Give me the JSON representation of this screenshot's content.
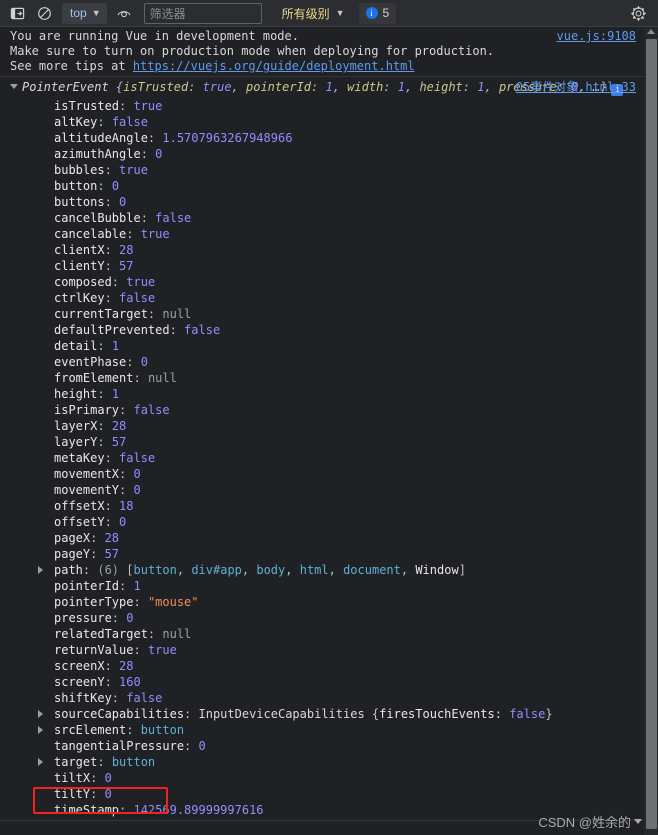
{
  "toolbar": {
    "sidebar_toggle_title": "Show console sidebar",
    "clear_title": "Clear console",
    "context_label": "top",
    "eye_title": "Live expression",
    "filter_placeholder": "筛选器",
    "filter_value": "",
    "level_label": "所有级别",
    "issues_count": "5",
    "issues_icon_char": "i",
    "settings_title": "Console settings"
  },
  "warning": {
    "line1": "You are running Vue in development mode.",
    "line2": "Make sure to turn on production mode when deploying for production.",
    "line3_prefix": "See more tips at ",
    "line3_link": "https://vuejs.org/guide/deployment.html",
    "source": "vue.js:9108"
  },
  "event_group": {
    "source": "05事件对象.html:33",
    "class_name": "PointerEvent",
    "preview_open": "{",
    "preview_items": [
      {
        "key": "isTrusted",
        "value": "true"
      },
      {
        "key": "pointerId",
        "value": "1"
      },
      {
        "key": "width",
        "value": "1"
      },
      {
        "key": "height",
        "value": "1"
      },
      {
        "key": "pressure",
        "value": "0"
      }
    ],
    "preview_ellipsis": "…}",
    "info_badge": "i",
    "properties": [
      {
        "key": "isTrusted",
        "value": "true",
        "type": "bool",
        "expandable": false
      },
      {
        "key": "altKey",
        "value": "false",
        "type": "bool",
        "expandable": false
      },
      {
        "key": "altitudeAngle",
        "value": "1.5707963267948966",
        "type": "num",
        "expandable": false
      },
      {
        "key": "azimuthAngle",
        "value": "0",
        "type": "num",
        "expandable": false
      },
      {
        "key": "bubbles",
        "value": "true",
        "type": "bool",
        "expandable": false
      },
      {
        "key": "button",
        "value": "0",
        "type": "num",
        "expandable": false
      },
      {
        "key": "buttons",
        "value": "0",
        "type": "num",
        "expandable": false
      },
      {
        "key": "cancelBubble",
        "value": "false",
        "type": "bool",
        "expandable": false
      },
      {
        "key": "cancelable",
        "value": "true",
        "type": "bool",
        "expandable": false
      },
      {
        "key": "clientX",
        "value": "28",
        "type": "num",
        "expandable": false
      },
      {
        "key": "clientY",
        "value": "57",
        "type": "num",
        "expandable": false
      },
      {
        "key": "composed",
        "value": "true",
        "type": "bool",
        "expandable": false
      },
      {
        "key": "ctrlKey",
        "value": "false",
        "type": "bool",
        "expandable": false
      },
      {
        "key": "currentTarget",
        "value": "null",
        "type": "null",
        "expandable": false
      },
      {
        "key": "defaultPrevented",
        "value": "false",
        "type": "bool",
        "expandable": false
      },
      {
        "key": "detail",
        "value": "1",
        "type": "num",
        "expandable": false
      },
      {
        "key": "eventPhase",
        "value": "0",
        "type": "num",
        "expandable": false
      },
      {
        "key": "fromElement",
        "value": "null",
        "type": "null",
        "expandable": false
      },
      {
        "key": "height",
        "value": "1",
        "type": "num",
        "expandable": false
      },
      {
        "key": "isPrimary",
        "value": "false",
        "type": "bool",
        "expandable": false
      },
      {
        "key": "layerX",
        "value": "28",
        "type": "num",
        "expandable": false
      },
      {
        "key": "layerY",
        "value": "57",
        "type": "num",
        "expandable": false
      },
      {
        "key": "metaKey",
        "value": "false",
        "type": "bool",
        "expandable": false
      },
      {
        "key": "movementX",
        "value": "0",
        "type": "num",
        "expandable": false
      },
      {
        "key": "movementY",
        "value": "0",
        "type": "num",
        "expandable": false
      },
      {
        "key": "offsetX",
        "value": "18",
        "type": "num",
        "expandable": false
      },
      {
        "key": "offsetY",
        "value": "0",
        "type": "num",
        "expandable": false
      },
      {
        "key": "pageX",
        "value": "28",
        "type": "num",
        "expandable": false
      },
      {
        "key": "pageY",
        "value": "57",
        "type": "num",
        "expandable": false
      },
      {
        "key": "path",
        "value": "",
        "type": "array",
        "expandable": true,
        "count": "(6)",
        "open": "[",
        "close": "]",
        "nodes": [
          "button",
          "div#app",
          "body",
          "html",
          "document",
          "Window"
        ],
        "window_index": 5
      },
      {
        "key": "pointerId",
        "value": "1",
        "type": "num",
        "expandable": false
      },
      {
        "key": "pointerType",
        "value": "\"mouse\"",
        "type": "str",
        "expandable": false
      },
      {
        "key": "pressure",
        "value": "0",
        "type": "num",
        "expandable": false
      },
      {
        "key": "relatedTarget",
        "value": "null",
        "type": "null",
        "expandable": false
      },
      {
        "key": "returnValue",
        "value": "true",
        "type": "bool",
        "expandable": false
      },
      {
        "key": "screenX",
        "value": "28",
        "type": "num",
        "expandable": false
      },
      {
        "key": "screenY",
        "value": "160",
        "type": "num",
        "expandable": false
      },
      {
        "key": "shiftKey",
        "value": "false",
        "type": "bool",
        "expandable": false
      },
      {
        "key": "sourceCapabilities",
        "value": "",
        "type": "object",
        "expandable": true,
        "class_name": "InputDeviceCapabilities",
        "sub_open": "{",
        "sub_key": "firesTouchEvents",
        "sub_value": "false",
        "sub_close": "}"
      },
      {
        "key": "srcElement",
        "value": "button",
        "type": "node",
        "expandable": true
      },
      {
        "key": "tangentialPressure",
        "value": "0",
        "type": "num",
        "expandable": false
      },
      {
        "key": "target",
        "value": "button",
        "type": "node",
        "expandable": true,
        "highlighted": true
      },
      {
        "key": "tiltX",
        "value": "0",
        "type": "num",
        "expandable": false
      },
      {
        "key": "tiltY",
        "value": "0",
        "type": "num",
        "expandable": false
      },
      {
        "key": "timeStamp",
        "value": "142569.89999997616",
        "type": "num",
        "expandable": false
      }
    ]
  },
  "annotation": {
    "color": "#f52121",
    "target_row_key": "target"
  },
  "watermark": {
    "text": "CSDN @姓余的"
  }
}
